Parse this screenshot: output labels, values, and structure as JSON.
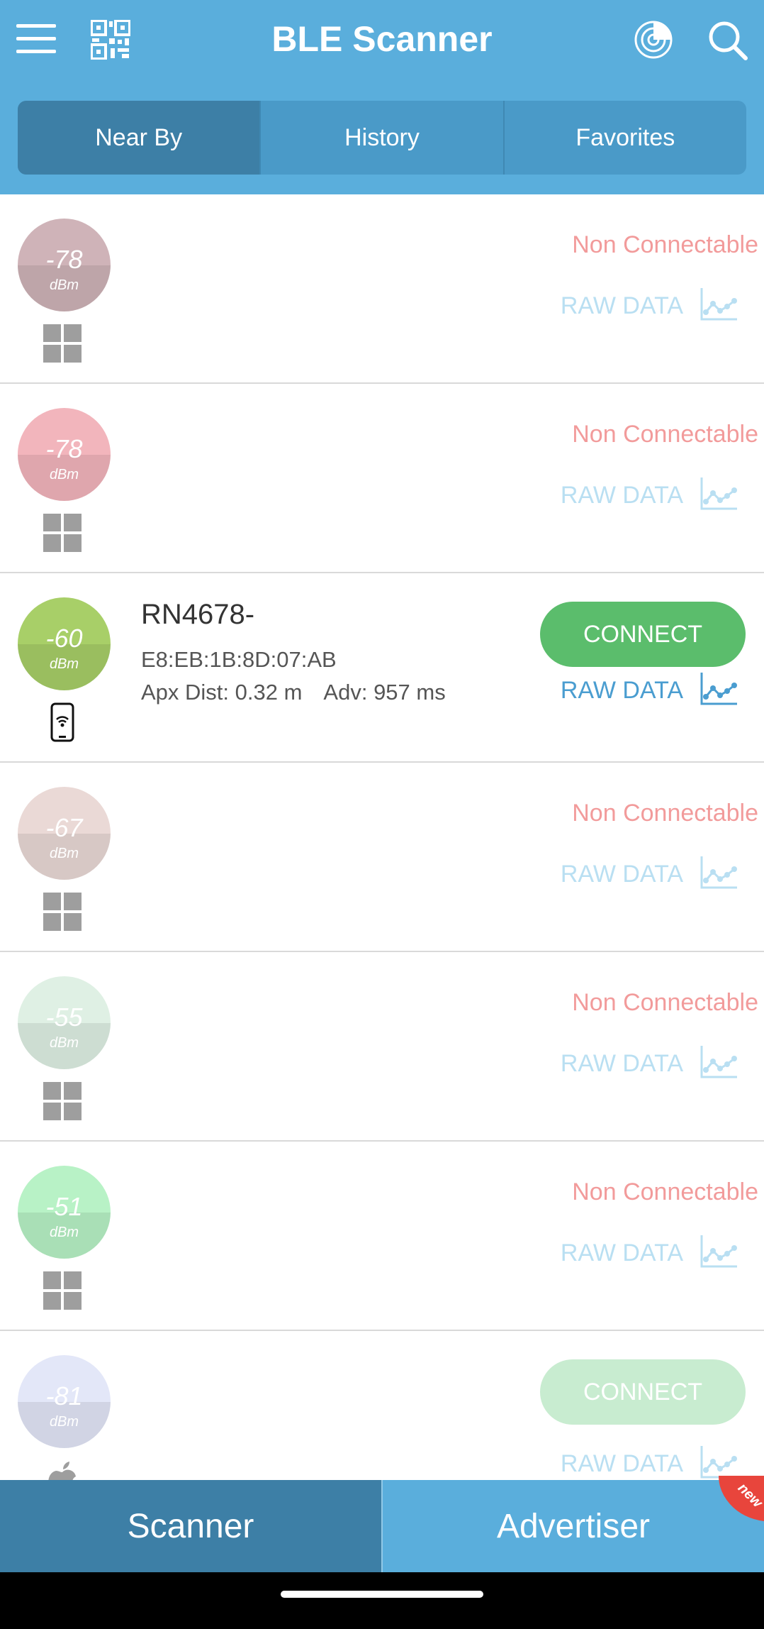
{
  "header": {
    "title": "BLE Scanner",
    "icons": [
      "menu-icon",
      "qr-code-icon",
      "radar-icon",
      "search-icon"
    ]
  },
  "tabs": [
    {
      "label": "Near By",
      "active": true
    },
    {
      "label": "History",
      "active": false
    },
    {
      "label": "Favorites",
      "active": false
    }
  ],
  "devices": [
    {
      "rssi": "-78",
      "unit": "dBm",
      "color": "#cfb3b8",
      "type_icon": "windows-icon",
      "status": "Non Connectable",
      "raw": "RAW DATA"
    },
    {
      "rssi": "-78",
      "unit": "dBm",
      "color": "#f2b5bc",
      "type_icon": "windows-icon",
      "status": "Non Connectable",
      "raw": "RAW DATA"
    },
    {
      "rssi": "-60",
      "unit": "dBm",
      "color": "#a8cf68",
      "type_icon": "phone-icon",
      "name": "RN4678-",
      "mac": "E8:EB:1B:8D:07:AB",
      "dist": "Apx Dist: 0.32 m",
      "adv": "Adv: 957 ms",
      "connect": "CONNECT",
      "raw": "RAW DATA"
    },
    {
      "rssi": "-67",
      "unit": "dBm",
      "color": "#ead9d6",
      "type_icon": "windows-icon",
      "status": "Non Connectable",
      "raw": "RAW DATA"
    },
    {
      "rssi": "-55",
      "unit": "dBm",
      "color": "#dff0e4",
      "type_icon": "windows-icon",
      "status": "Non Connectable",
      "raw": "RAW DATA"
    },
    {
      "rssi": "-51",
      "unit": "dBm",
      "color": "#b8f2c6",
      "type_icon": "windows-icon",
      "status": "Non Connectable",
      "raw": "RAW DATA"
    },
    {
      "rssi": "-81",
      "unit": "dBm",
      "color": "#e3e7f8",
      "type_icon": "apple-icon",
      "connect": "CONNECT",
      "raw": "RAW DATA"
    }
  ],
  "bottom": {
    "scanner": "Scanner",
    "advertiser": "Advertiser",
    "badge": "new"
  },
  "colors": {
    "header": "#5aaedc",
    "active_tab": "#3d7fa6",
    "non_connectable": "#f29b9b",
    "connect_green": "#5bbd6c",
    "raw_data_blue": "#4a9dd0"
  }
}
